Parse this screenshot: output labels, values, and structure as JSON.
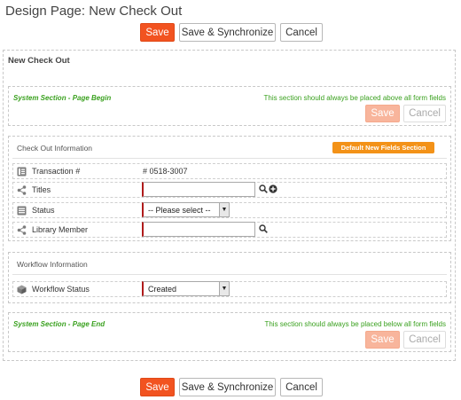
{
  "page": {
    "title": "Design Page: New Check Out"
  },
  "toolbar": {
    "save": "Save",
    "save_sync": "Save & Synchronize",
    "cancel": "Cancel"
  },
  "form": {
    "title": "New Check Out"
  },
  "page_begin": {
    "label": "System Section - Page Begin",
    "note": "This section should always be placed above all form fields",
    "save": "Save",
    "cancel": "Cancel"
  },
  "checkout_section": {
    "title": "Check Out Information",
    "badge": "Default New Fields Section",
    "fields": [
      {
        "label": "Transaction #",
        "icon": "list-icon",
        "value": "# 0518-3007"
      },
      {
        "label": "Titles",
        "icon": "share-icon",
        "value": ""
      },
      {
        "label": "Status",
        "icon": "list-lines-icon",
        "value": "-- Please select --"
      },
      {
        "label": "Library Member",
        "icon": "share-icon",
        "value": ""
      }
    ]
  },
  "workflow_section": {
    "title": "Workflow Information",
    "fields": [
      {
        "label": "Workflow Status",
        "icon": "cube-icon",
        "value": "Created"
      }
    ]
  },
  "page_end": {
    "label": "System Section - Page End",
    "note": "This section should always be placed below all form fields",
    "save": "Save",
    "cancel": "Cancel"
  },
  "colors": {
    "accent": "#f25320",
    "accent_disabled": "#f8b59c",
    "system_green": "#3aa11f",
    "badge": "#f39218",
    "required": "#b01b1b"
  }
}
